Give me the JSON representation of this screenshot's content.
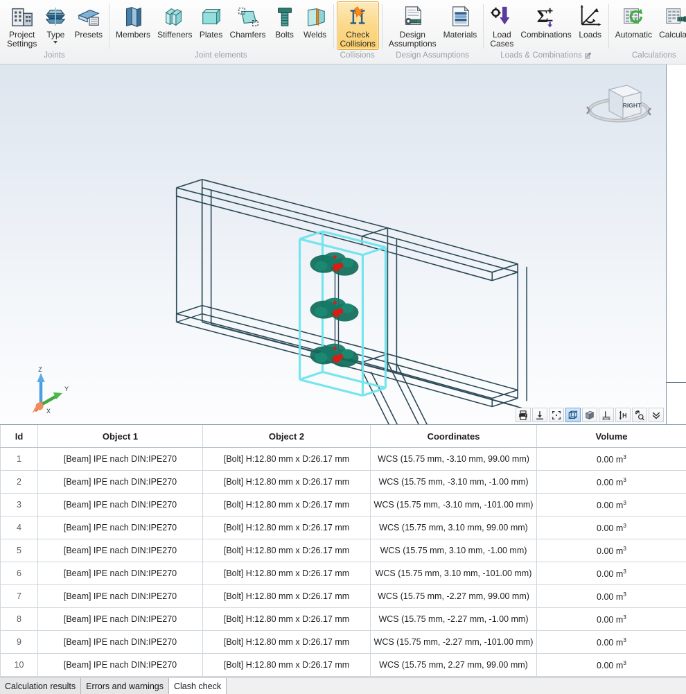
{
  "ribbon": {
    "groups": [
      {
        "label": "Joints",
        "label_name": "ribbon-group-label-joints",
        "items": [
          {
            "label": "Project\nSettings",
            "icon": "project-settings-icon",
            "name": "ribbon-button-project-settings",
            "caret": false,
            "active": false
          },
          {
            "label": "Type",
            "icon": "joint-type-icon",
            "name": "ribbon-button-type",
            "caret": true,
            "active": false
          },
          {
            "label": "Presets",
            "icon": "presets-icon",
            "name": "ribbon-button-presets",
            "caret": false,
            "active": false
          }
        ]
      },
      {
        "label": "Joint elements",
        "label_name": "ribbon-group-label-joint-elements",
        "items": [
          {
            "label": "Members",
            "icon": "members-icon",
            "name": "ribbon-button-members",
            "caret": false,
            "active": false
          },
          {
            "label": "Stiffeners",
            "icon": "stiffeners-icon",
            "name": "ribbon-button-stiffeners",
            "caret": false,
            "active": false
          },
          {
            "label": "Plates",
            "icon": "plates-icon",
            "name": "ribbon-button-plates",
            "caret": false,
            "active": false
          },
          {
            "label": "Chamfers",
            "icon": "chamfers-icon",
            "name": "ribbon-button-chamfers",
            "caret": false,
            "active": false
          },
          {
            "label": "Bolts",
            "icon": "bolts-icon",
            "name": "ribbon-button-bolts",
            "caret": false,
            "active": false
          },
          {
            "label": "Welds",
            "icon": "welds-icon",
            "name": "ribbon-button-welds",
            "caret": false,
            "active": false
          }
        ]
      },
      {
        "label": "Collisions",
        "label_name": "ribbon-group-label-collisions",
        "items": [
          {
            "label": "Check\nCollisions",
            "icon": "check-collisions-icon",
            "name": "ribbon-button-check-collisions",
            "caret": false,
            "active": true
          }
        ]
      },
      {
        "label": "Design Assumptions",
        "label_name": "ribbon-group-label-design-assumptions",
        "items": [
          {
            "label": "Design\nAssumptions",
            "icon": "design-assumptions-icon",
            "name": "ribbon-button-design-assumptions",
            "caret": false,
            "active": false
          },
          {
            "label": "Materials",
            "icon": "materials-icon",
            "name": "ribbon-button-materials",
            "caret": false,
            "active": false
          }
        ]
      },
      {
        "label": "Loads & Combinations",
        "label_name": "ribbon-group-label-loads-combinations",
        "launcher": true,
        "items": [
          {
            "label": "Load\nCases",
            "icon": "load-cases-icon",
            "name": "ribbon-button-load-cases",
            "caret": false,
            "active": false
          },
          {
            "label": "Combinations",
            "icon": "combinations-icon",
            "name": "ribbon-button-combinations",
            "caret": false,
            "active": false
          },
          {
            "label": "Loads",
            "icon": "loads-icon",
            "name": "ribbon-button-loads",
            "caret": false,
            "active": false
          }
        ]
      },
      {
        "label": "Calculations",
        "label_name": "ribbon-group-label-calculations",
        "items": [
          {
            "label": "Automatic",
            "icon": "automatic-calculation-icon",
            "name": "ribbon-button-automatic",
            "caret": false,
            "active": false
          },
          {
            "label": "Calculate",
            "icon": "calculate-icon",
            "name": "ribbon-button-calculate",
            "caret": false,
            "active": false
          }
        ]
      }
    ]
  },
  "viewport": {
    "viewcube": {
      "face_label": "RIGHT",
      "name": "view-cube"
    },
    "axis_triad": {
      "x_label": "X",
      "y_label": "Y",
      "z_label": "Z",
      "x_color": "#e8784a",
      "y_color": "#3faa3c",
      "z_color": "#4a9fe0"
    },
    "colors": {
      "model_line": "#2b4a57",
      "collision_highlight": "#6fe4ee",
      "bolt_body": "#11705e",
      "bolt_marker": "#d81e12"
    },
    "toolbar": [
      {
        "icon": "print-icon",
        "name": "viewport-print-button",
        "selected": false
      },
      {
        "icon": "save-image-icon",
        "name": "viewport-save-image-button",
        "selected": false
      },
      {
        "icon": "fit-to-screen-icon",
        "name": "viewport-fit-button",
        "selected": false
      },
      {
        "icon": "wireframe-view-icon",
        "name": "viewport-wireframe-button",
        "selected": true
      },
      {
        "icon": "solid-view-icon",
        "name": "viewport-solid-button",
        "selected": false
      },
      {
        "icon": "measure-distance-icon",
        "name": "viewport-measure-distance-button",
        "selected": false
      },
      {
        "icon": "measure-height-icon",
        "name": "viewport-measure-height-button",
        "selected": false
      },
      {
        "icon": "zoom-window-icon",
        "name": "viewport-zoom-window-button",
        "selected": false
      },
      {
        "icon": "chevron-down-icon",
        "name": "viewport-more-button",
        "selected": false
      }
    ]
  },
  "results_table": {
    "columns": [
      {
        "key": "id",
        "label": "Id"
      },
      {
        "key": "obj1",
        "label": "Object 1"
      },
      {
        "key": "obj2",
        "label": "Object 2"
      },
      {
        "key": "coords",
        "label": "Coordinates"
      },
      {
        "key": "volume",
        "label": "Volume"
      }
    ],
    "rows": [
      {
        "id": "1",
        "obj1": "[Beam] IPE nach DIN:IPE270",
        "obj2": "[Bolt] H:12.80 mm x D:26.17 mm",
        "coords": "WCS (15.75 mm, -3.10 mm, 99.00 mm)",
        "volume_value": "0.00 m",
        "volume_exp": "3"
      },
      {
        "id": "2",
        "obj1": "[Beam] IPE nach DIN:IPE270",
        "obj2": "[Bolt] H:12.80 mm x D:26.17 mm",
        "coords": "WCS (15.75 mm, -3.10 mm, -1.00 mm)",
        "volume_value": "0.00 m",
        "volume_exp": "3"
      },
      {
        "id": "3",
        "obj1": "[Beam] IPE nach DIN:IPE270",
        "obj2": "[Bolt] H:12.80 mm x D:26.17 mm",
        "coords": "WCS (15.75 mm, -3.10 mm, -101.00 mm)",
        "volume_value": "0.00 m",
        "volume_exp": "3"
      },
      {
        "id": "4",
        "obj1": "[Beam] IPE nach DIN:IPE270",
        "obj2": "[Bolt] H:12.80 mm x D:26.17 mm",
        "coords": "WCS (15.75 mm, 3.10 mm, 99.00 mm)",
        "volume_value": "0.00 m",
        "volume_exp": "3"
      },
      {
        "id": "5",
        "obj1": "[Beam] IPE nach DIN:IPE270",
        "obj2": "[Bolt] H:12.80 mm x D:26.17 mm",
        "coords": "WCS (15.75 mm, 3.10 mm, -1.00 mm)",
        "volume_value": "0.00 m",
        "volume_exp": "3"
      },
      {
        "id": "6",
        "obj1": "[Beam] IPE nach DIN:IPE270",
        "obj2": "[Bolt] H:12.80 mm x D:26.17 mm",
        "coords": "WCS (15.75 mm, 3.10 mm, -101.00 mm)",
        "volume_value": "0.00 m",
        "volume_exp": "3"
      },
      {
        "id": "7",
        "obj1": "[Beam] IPE nach DIN:IPE270",
        "obj2": "[Bolt] H:12.80 mm x D:26.17 mm",
        "coords": "WCS (15.75 mm, -2.27 mm, 99.00 mm)",
        "volume_value": "0.00 m",
        "volume_exp": "3"
      },
      {
        "id": "8",
        "obj1": "[Beam] IPE nach DIN:IPE270",
        "obj2": "[Bolt] H:12.80 mm x D:26.17 mm",
        "coords": "WCS (15.75 mm, -2.27 mm, -1.00 mm)",
        "volume_value": "0.00 m",
        "volume_exp": "3"
      },
      {
        "id": "9",
        "obj1": "[Beam] IPE nach DIN:IPE270",
        "obj2": "[Bolt] H:12.80 mm x D:26.17 mm",
        "coords": "WCS (15.75 mm, -2.27 mm, -101.00 mm)",
        "volume_value": "0.00 m",
        "volume_exp": "3"
      },
      {
        "id": "10",
        "obj1": "[Beam] IPE nach DIN:IPE270",
        "obj2": "[Bolt] H:12.80 mm x D:26.17 mm",
        "coords": "WCS (15.75 mm, 2.27 mm, 99.00 mm)",
        "volume_value": "0.00 m",
        "volume_exp": "3"
      }
    ]
  },
  "bottom_tabs": {
    "items": [
      {
        "label": "Calculation results",
        "name": "tab-calculation-results",
        "active": false
      },
      {
        "label": "Errors and warnings",
        "name": "tab-errors-and-warnings",
        "active": false
      },
      {
        "label": "Clash check",
        "name": "tab-clash-check",
        "active": true
      }
    ]
  }
}
